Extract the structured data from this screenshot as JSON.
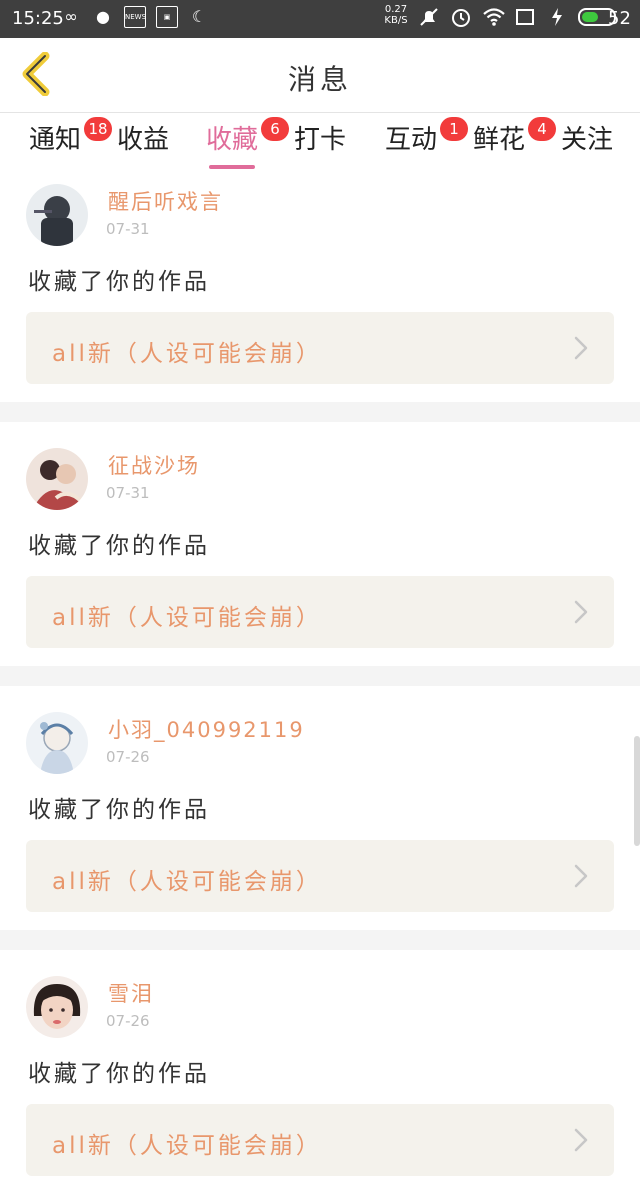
{
  "status_bar": {
    "time": "15:25",
    "net_speed_value": "0.27",
    "net_speed_unit": "KB/S",
    "news_label": "NEWS",
    "battery_level": 0.52,
    "battery_percent": "52"
  },
  "header": {
    "title": "消息"
  },
  "tabs": [
    {
      "label": "通知",
      "badge": "18"
    },
    {
      "label": "收益",
      "badge": ""
    },
    {
      "label": "收藏",
      "badge": "6",
      "active": true
    },
    {
      "label": "打卡",
      "badge": ""
    },
    {
      "label": "互动",
      "badge": "1"
    },
    {
      "label": "鲜花",
      "badge": "4"
    },
    {
      "label": "关注",
      "badge": ""
    }
  ],
  "feed": [
    {
      "username": "醒后听戏言",
      "date": "07-31",
      "action": "收藏了你的作品",
      "work_title": "all新（人设可能会崩）"
    },
    {
      "username": "征战沙场",
      "date": "07-31",
      "action": "收藏了你的作品",
      "work_title": "all新（人设可能会崩）"
    },
    {
      "username": "小羽_040992119",
      "date": "07-26",
      "action": "收藏了你的作品",
      "work_title": "all新（人设可能会崩）"
    },
    {
      "username": "雪泪",
      "date": "07-26",
      "action": "收藏了你的作品",
      "work_title": "all新（人设可能会崩）"
    }
  ],
  "colors": {
    "accent_pink": "#e06c9a",
    "accent_orange": "#e8976c",
    "badge_red": "#f23b3b",
    "back_arrow_yellow": "#f0cc3a"
  }
}
